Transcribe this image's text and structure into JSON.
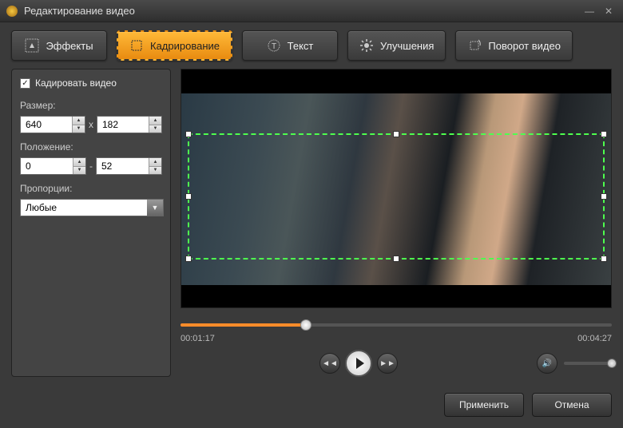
{
  "window": {
    "title": "Редактирование видео"
  },
  "tabs": {
    "effects": "Эффекты",
    "crop": "Кадрирование",
    "text": "Текст",
    "enhance": "Улучшения",
    "rotate": "Поворот видео"
  },
  "panel": {
    "enable_crop": "Кадировать видео",
    "size_label": "Размер:",
    "width": "640",
    "height": "182",
    "size_sep": "x",
    "position_label": "Положение:",
    "pos_x": "0",
    "pos_y": "52",
    "pos_sep": "-",
    "ratio_label": "Пропорции:",
    "ratio_value": "Любые"
  },
  "player": {
    "current_time": "00:01:17",
    "total_time": "00:04:27"
  },
  "footer": {
    "apply": "Применить",
    "cancel": "Отмена"
  }
}
